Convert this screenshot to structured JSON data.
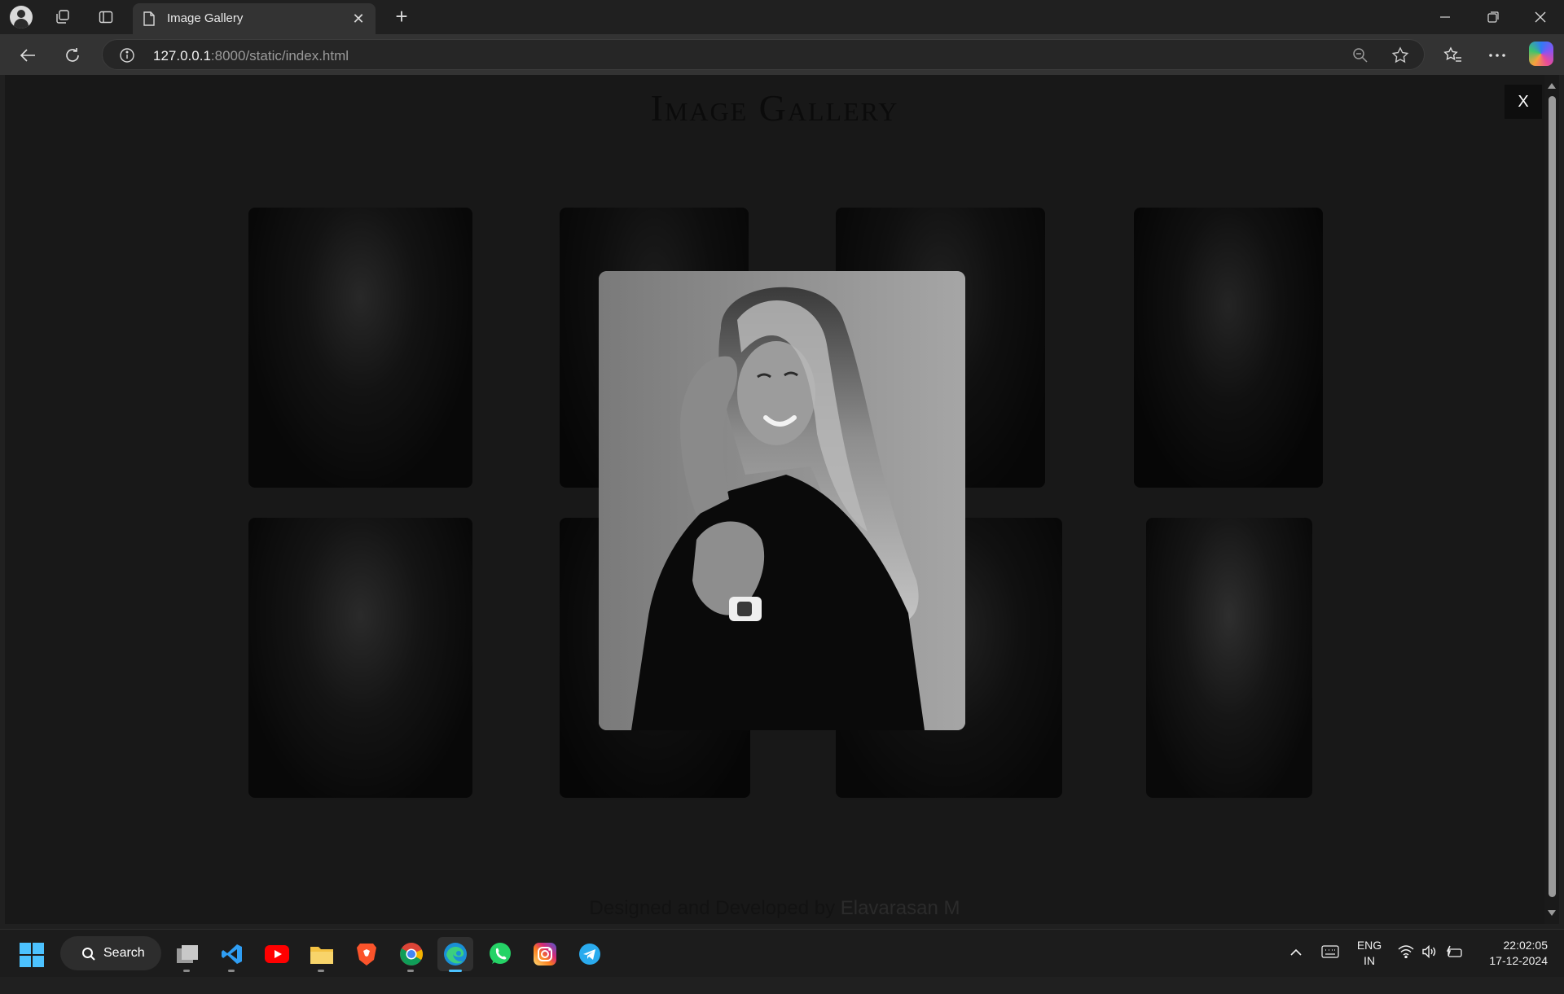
{
  "browser": {
    "tab_title": "Image Gallery",
    "url_host": "127.0.0.1",
    "url_rest": ":8000/static/index.html"
  },
  "page": {
    "title": "Image Gallery",
    "close_label": "X",
    "footer_prefix": "Designed and Developed by ",
    "footer_author": "Elavarasan M",
    "thumbnails": [
      {
        "subject": "man with glasses"
      },
      {
        "subject": "man"
      },
      {
        "subject": "man in suit"
      },
      {
        "subject": "man in suit and tie"
      },
      {
        "subject": "woman with hands under chin"
      },
      {
        "subject": "person"
      },
      {
        "subject": "woman"
      },
      {
        "subject": "woman portrait"
      }
    ],
    "lightbox": {
      "subject": "smiling woman with long hair and watch"
    }
  },
  "taskbar": {
    "search_label": "Search",
    "apps": [
      "file-manager",
      "vs-code",
      "youtube",
      "file-explorer",
      "brave",
      "chrome",
      "edge",
      "whatsapp",
      "instagram",
      "telegram"
    ],
    "lang_line1": "ENG",
    "lang_line2": "IN",
    "time": "22:02:05",
    "date": "17-12-2024"
  },
  "colors": {
    "accent": "#4cc2ff",
    "page_bg": "#181818",
    "chrome_bg": "#202020"
  }
}
